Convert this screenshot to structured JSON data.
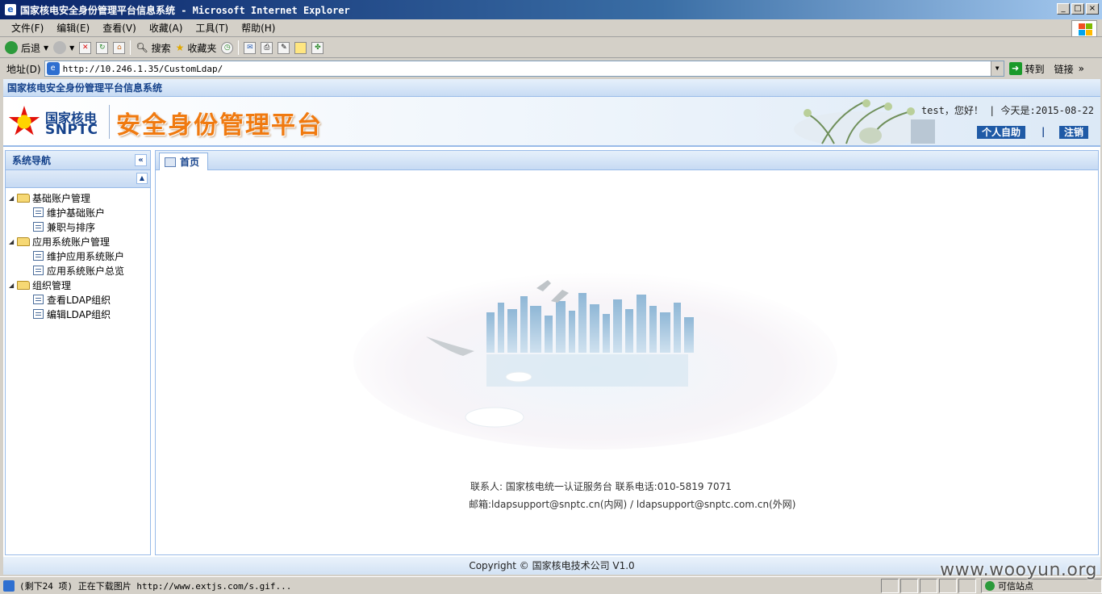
{
  "window": {
    "title": "国家核电安全身份管理平台信息系统 - Microsoft Internet Explorer",
    "controls": [
      "_",
      "□",
      "×"
    ]
  },
  "menubar": {
    "items": [
      "文件(F)",
      "编辑(E)",
      "查看(V)",
      "收藏(A)",
      "工具(T)",
      "帮助(H)"
    ]
  },
  "toolbar": {
    "back": "后退",
    "search": "搜索",
    "favorites": "收藏夹"
  },
  "addressbar": {
    "label": "地址(D)",
    "url": "http://10.246.1.35/CustomLdap/",
    "go": "转到",
    "links": "链接"
  },
  "app": {
    "header_title": "国家核电安全身份管理平台信息系统",
    "logo_cn": "国家核电",
    "logo_en": "SNPTC",
    "platform_title": "安全身份管理平台",
    "greeting": "test，您好！ | 今天是:2015-08-22",
    "self_service": "个人自助",
    "separator": "|",
    "logout": "注销"
  },
  "nav": {
    "title": "系统导航",
    "groups": [
      {
        "label": "基础账户管理",
        "items": [
          "维护基础账户",
          "兼职与排序"
        ]
      },
      {
        "label": "应用系统账户管理",
        "items": [
          "维护应用系统账户",
          "应用系统账户总览"
        ]
      },
      {
        "label": "组织管理",
        "items": [
          "查看LDAP组织",
          "编辑LDAP组织"
        ]
      }
    ]
  },
  "tabs": {
    "home": "首页"
  },
  "contact": {
    "line1": "联系人: 国家核电统一认证服务台      联系电话:010-5819 7071",
    "line2": "邮箱:ldapsupport@snptc.cn(内网) / ldapsupport@snptc.com.cn(外网)"
  },
  "footer": {
    "copyright": "Copyright © 国家核电技术公司  V1.0"
  },
  "statusbar": {
    "text": "(剩下24 项) 正在下载图片 http://www.extjs.com/s.gif...",
    "zone": "可信站点"
  },
  "watermark": "www.wooyun.org",
  "colors": {
    "accent": "#15428b",
    "title_orange": "#f07a10",
    "panel_border": "#99bbe8"
  }
}
